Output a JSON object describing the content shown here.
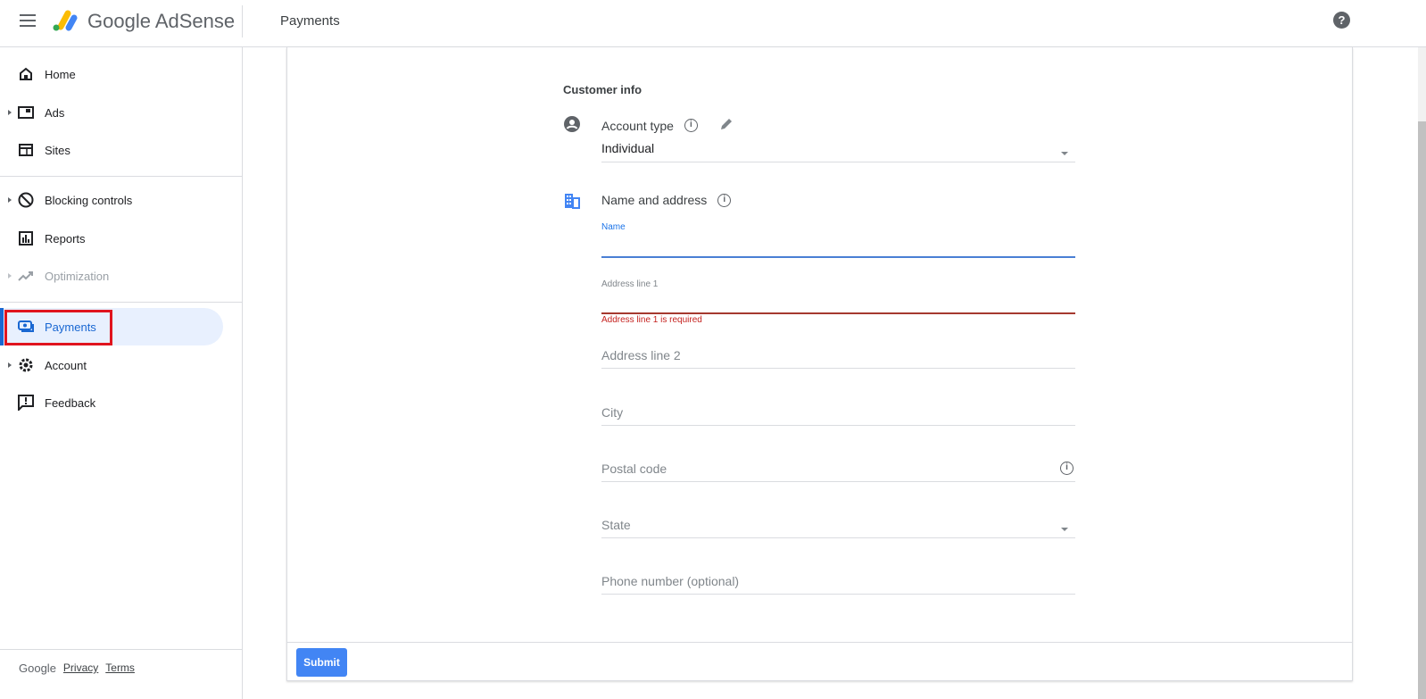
{
  "header": {
    "brand": "Google AdSense",
    "page_title": "Payments",
    "help_icon": "help-circle-icon"
  },
  "sidebar": {
    "items": [
      {
        "label": "Home",
        "icon": "home-icon"
      },
      {
        "label": "Ads",
        "icon": "ads-icon",
        "expandable": true
      },
      {
        "label": "Sites",
        "icon": "sites-icon"
      },
      {
        "label": "Blocking controls",
        "icon": "block-icon",
        "expandable": true
      },
      {
        "label": "Reports",
        "icon": "reports-icon"
      },
      {
        "label": "Optimization",
        "icon": "trending-up-icon",
        "expandable": true,
        "disabled": true
      },
      {
        "label": "Payments",
        "icon": "payments-icon",
        "active": true
      },
      {
        "label": "Account",
        "icon": "gear-icon",
        "expandable": true
      },
      {
        "label": "Feedback",
        "icon": "feedback-icon"
      }
    ],
    "footer": {
      "google": "Google",
      "privacy": "Privacy",
      "terms": "Terms"
    }
  },
  "form": {
    "section_title": "Customer info",
    "account_type": {
      "label": "Account type",
      "value": "Individual"
    },
    "name_address": {
      "label": "Name and address"
    },
    "fields": {
      "name": {
        "label": "Name",
        "value": ""
      },
      "address1": {
        "label": "Address line 1",
        "value": "",
        "error": "Address line 1 is required"
      },
      "address2": {
        "placeholder": "Address line 2"
      },
      "city": {
        "placeholder": "City"
      },
      "postal": {
        "placeholder": "Postal code"
      },
      "state": {
        "placeholder": "State"
      },
      "phone": {
        "placeholder": "Phone number (optional)"
      }
    },
    "submit": "Submit"
  },
  "colors": {
    "accent": "#1967d2",
    "error": "#c5221f",
    "button": "#4285f4",
    "highlight_box": "#e0141e"
  }
}
